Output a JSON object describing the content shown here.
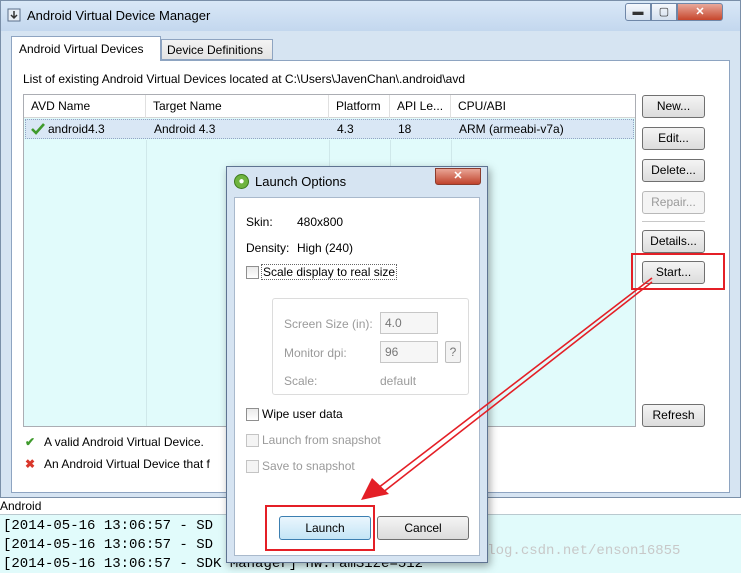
{
  "window": {
    "title": "Android Virtual Device Manager",
    "controls": {
      "minimize": "▬",
      "maximize": "▢",
      "close": "✕"
    }
  },
  "tabs": [
    {
      "label": "Android Virtual Devices",
      "selected": true
    },
    {
      "label": "Device Definitions",
      "selected": false
    }
  ],
  "avd_list": {
    "caption": "List of existing Android Virtual Devices located at C:\\Users\\JavenChan\\.android\\avd",
    "columns": [
      "AVD Name",
      "Target Name",
      "Platform",
      "API Le...",
      "CPU/ABI"
    ],
    "rows": [
      {
        "status_icon": "valid-check-icon",
        "name": "android4.3",
        "target": "Android 4.3",
        "platform": "4.3",
        "api": "18",
        "cpu": "ARM (armeabi-v7a)"
      }
    ]
  },
  "side_buttons": {
    "new": "New...",
    "edit": "Edit...",
    "delete": "Delete...",
    "repair": "Repair...",
    "details": "Details...",
    "start": "Start...",
    "refresh": "Refresh"
  },
  "legend": {
    "valid": "A valid Android Virtual Device.",
    "invalid": "An Android Virtual Device that f"
  },
  "log": {
    "label": "Android",
    "lines": [
      "[2014-05-16 13:06:57 - SD",
      "[2014-05-16 13:06:57 - SD",
      "[2014-05-16 13:06:57 - SDK Manager] hw.ramSize=512"
    ]
  },
  "launch_dialog": {
    "title": "Launch Options",
    "close": "✕",
    "skin_label": "Skin:",
    "skin_value": "480x800",
    "density_label": "Density:",
    "density_value": "High (240)",
    "scale_checkbox": "Scale display to real size",
    "screen_size_label": "Screen Size (in):",
    "screen_size_value": "4.0",
    "monitor_dpi_label": "Monitor dpi:",
    "monitor_dpi_value": "96",
    "help": "?",
    "scale_label": "Scale:",
    "scale_value": "default",
    "wipe_checkbox": "Wipe user data",
    "launch_snapshot_checkbox": "Launch from snapshot",
    "save_snapshot_checkbox": "Save to snapshot",
    "launch_button": "Launch",
    "cancel_button": "Cancel"
  },
  "watermark": "http://blog.csdn.net/enson16855",
  "colors": {
    "annotation_red": "#e41f26",
    "list_background": "#e1fbfb",
    "selected_row": "#d9e7f5",
    "valid_green": "#3f9a2c",
    "invalid_red": "#d9372b"
  }
}
